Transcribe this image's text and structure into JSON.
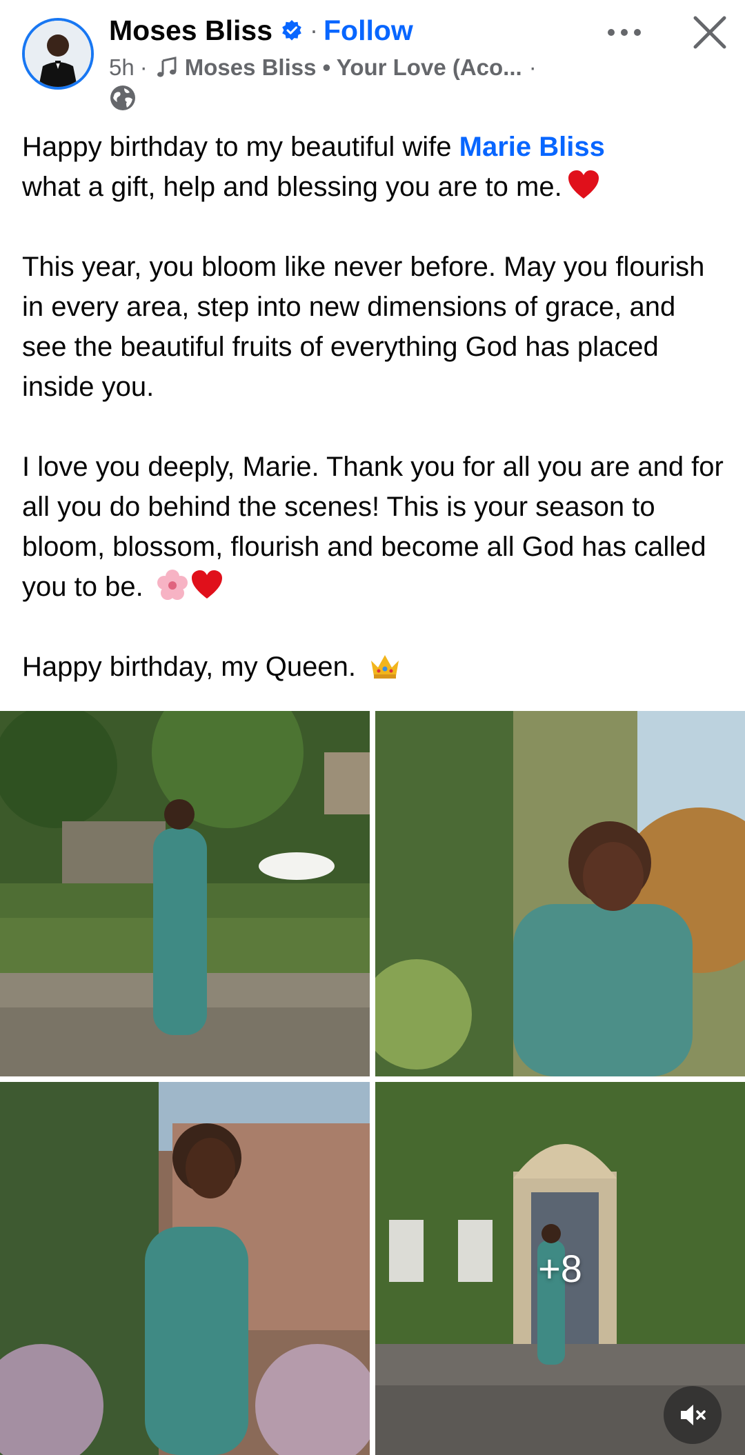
{
  "header": {
    "author_name": "Moses Bliss",
    "separator": "·",
    "follow_label": "Follow",
    "time": "5h",
    "meta_sep": "·",
    "music_label": "Moses Bliss • Your Love (Aco...",
    "meta_trailing": "·",
    "privacy_icon": "globe-icon",
    "verified_icon": "verified-badge-icon",
    "more_icon": "more-dots-icon",
    "close_icon": "close-icon"
  },
  "caption": {
    "line1_before": "Happy birthday to my beautiful wife ",
    "mention": "Marie Bliss",
    "line1_after": "what a gift, help and blessing you are to me.",
    "para2": "This year, you bloom like never before. May you flourish in every area, step into new dimensions of grace, and see the beautiful fruits of everything God has placed inside you.",
    "para3": "I love you deeply, Marie. Thank you for all you are and for all you do behind the scenes! This is your season to bloom, blossom, flourish and become all God has called you to be.",
    "para4": "Happy birthday, my Queen."
  },
  "media": {
    "more_count": "+8",
    "mute_icon": "speaker-muted-icon"
  },
  "colors": {
    "brand_blue": "#0866ff",
    "text": "#050505",
    "secondary_text": "#65676b"
  }
}
